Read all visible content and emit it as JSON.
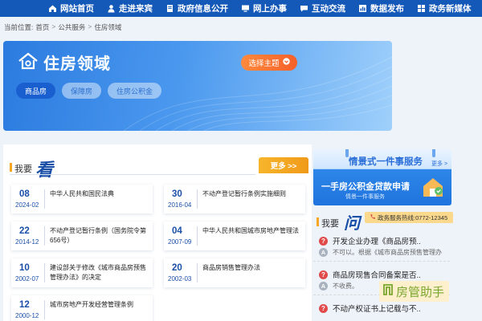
{
  "nav": [
    {
      "label": "网站首页",
      "icon": "home-icon"
    },
    {
      "label": "走进来宾",
      "icon": "person-icon"
    },
    {
      "label": "政府信息公开",
      "icon": "document-icon"
    },
    {
      "label": "网上办事",
      "icon": "computer-icon"
    },
    {
      "label": "互动交流",
      "icon": "chat-icon"
    },
    {
      "label": "数据发布",
      "icon": "bar-chart-icon"
    },
    {
      "label": "政务新媒体",
      "icon": "grid-icon"
    }
  ],
  "breadcrumb": {
    "prefix": "当前位置:",
    "items": [
      "首页",
      "公共服务",
      "住房领域"
    ],
    "separator": ">"
  },
  "banner": {
    "title": "住房领域",
    "choose_button": "选择主题",
    "tags": [
      "商品房",
      "保障房",
      "住房公积金"
    ]
  },
  "look": {
    "label": "我要",
    "calligraphy": "看",
    "more": "更多 >>"
  },
  "laws": [
    {
      "num": "08",
      "date": "2024-02",
      "title": "中华人民共和国民法典"
    },
    {
      "num": "30",
      "date": "2016-04",
      "title": "不动产登记暂行条例实施细则"
    },
    {
      "num": "22",
      "date": "2014-12",
      "title": "不动产登记暂行条例（国务院令第656号）"
    },
    {
      "num": "04",
      "date": "2007-09",
      "title": "中华人民共和国城市房地产管理法"
    },
    {
      "num": "10",
      "date": "2002-07",
      "title": "建设部关于修改《城市商品房预售管理办法》的决定"
    },
    {
      "num": "20",
      "date": "2002-03",
      "title": "商品房销售管理办法"
    },
    {
      "num": "12",
      "date": "2000-12",
      "title": "城市房地产开发经营管理条例"
    }
  ],
  "service": {
    "title": "情景式一件事服务",
    "more": "更多 >",
    "main": "一手房公积金贷款申请",
    "sub": "情景一件事服务"
  },
  "ask": {
    "label": "我要",
    "calligraphy": "问",
    "hotline": "政务服务热线:0772-12345"
  },
  "qa": [
    {
      "q": "开发企业办理《商品房预..",
      "a": "不可以。根据《城市商品房预售管理办"
    },
    {
      "q": "商品房现售合同备案是否..",
      "a": "不收费。"
    },
    {
      "q": "不动产权证书上记载与不..",
      "a": ""
    }
  ],
  "watermark": "房管助手",
  "colors": {
    "nav_bg": "#1458b8",
    "accent_orange": "#f5a623",
    "brand_blue": "#1a4fa8"
  }
}
